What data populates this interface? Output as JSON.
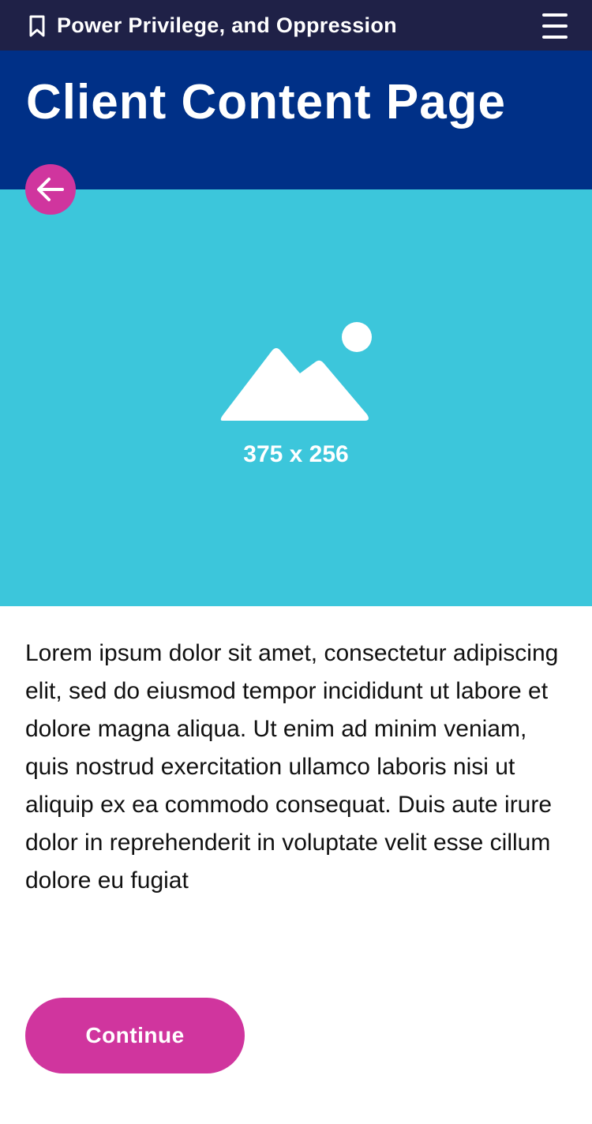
{
  "topbar": {
    "course_title": "Power Privilege, and Oppression",
    "bookmark_icon": "bookmark-icon",
    "menu_icon": "hamburger-menu-icon"
  },
  "header": {
    "title": "Client Content Page"
  },
  "back_button": {
    "icon": "arrow-left-icon"
  },
  "hero": {
    "placeholder_icon": "image-placeholder-icon",
    "dimensions_label": "375 x 256"
  },
  "body": {
    "paragraph": "Lorem ipsum dolor sit amet, consectetur adipiscing elit, sed do eiusmod tempor incididunt ut labore et dolore magna aliqua. Ut enim ad minim veniam, quis nostrud exercitation ullamco laboris nisi ut aliquip ex ea commodo consequat. Duis aute irure dolor in reprehenderit in voluptate velit esse cillum dolore eu fugiat"
  },
  "actions": {
    "continue_label": "Continue"
  },
  "colors": {
    "topbar": "#1f2147",
    "header": "#003087",
    "hero": "#3cc6db",
    "accent": "#d0359e",
    "text": "#111111"
  }
}
